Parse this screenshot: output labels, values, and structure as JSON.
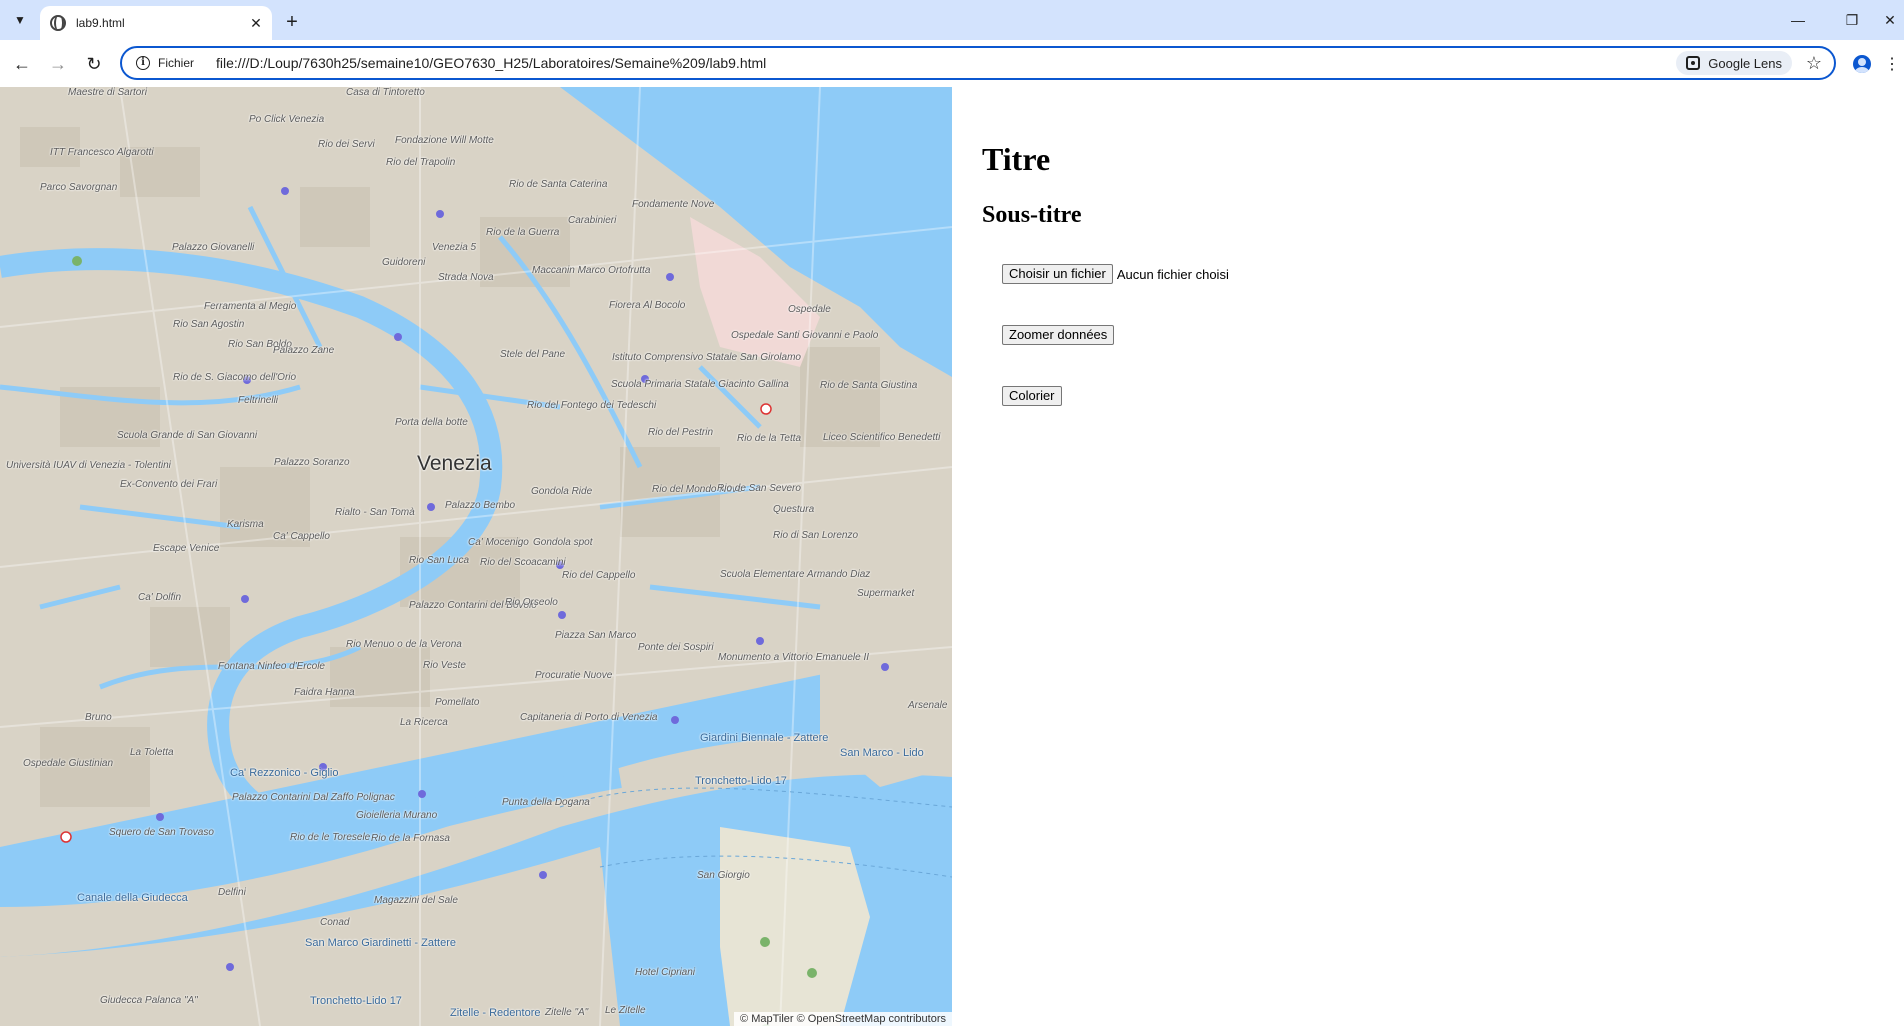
{
  "browser": {
    "tab_title": "lab9.html",
    "site_label": "Fichier",
    "url": "file:///D:/Loup/7630h25/semaine10/GEO7630_H25/Laboratoires/Semaine%209/lab9.html",
    "lens_label": "Google Lens"
  },
  "map": {
    "city_label": "Venezia",
    "labels": [
      {
        "text": "Maestre di Sartori"
      },
      {
        "text": "Casa di Tintoretto"
      },
      {
        "text": "Po Click Venezia"
      },
      {
        "text": "Rio dei Servi"
      },
      {
        "text": "Fondazione Will Motte"
      },
      {
        "text": "Rio del Trapolin"
      },
      {
        "text": "ITT Francesco Algarotti"
      },
      {
        "text": "Parco Savorgnan"
      },
      {
        "text": "Rio de Santa Caterina"
      },
      {
        "text": "Carabinieri"
      },
      {
        "text": "Fondamente Nove"
      },
      {
        "text": "Palazzo Giovanelli"
      },
      {
        "text": "Venezia 5"
      },
      {
        "text": "Rio de la Guerra"
      },
      {
        "text": "Guidoreni"
      },
      {
        "text": "Maccanin Marco Ortofrutta"
      },
      {
        "text": "Ferramenta al Megio"
      },
      {
        "text": "Strada Nova"
      },
      {
        "text": "Fiorera Al Bocolo"
      },
      {
        "text": "Ospedale"
      },
      {
        "text": "Rio San Agostin"
      },
      {
        "text": "Rio San Boldo"
      },
      {
        "text": "Palazzo Zane"
      },
      {
        "text": "Ospedale Santi Giovanni e Paolo"
      },
      {
        "text": "Stele del Pane"
      },
      {
        "text": "Istituto Comprensivo Statale San Girolamo"
      },
      {
        "text": "Rio de S. Giacomo dell'Orio"
      },
      {
        "text": "Feltrinelli"
      },
      {
        "text": "Scuola Primaria Statale Giacinto Gallina"
      },
      {
        "text": "Rio de Santa Giustina"
      },
      {
        "text": "Porta della botte"
      },
      {
        "text": "Rio del Fontego dei Tedeschi"
      },
      {
        "text": "Scuola Grande di San Giovanni"
      },
      {
        "text": "Rio del Pestrin"
      },
      {
        "text": "Rio de la Tetta"
      },
      {
        "text": "Liceo Scientifico Benedetti"
      },
      {
        "text": "Palazzo Soranzo"
      },
      {
        "text": "Università IUAV di Venezia - Tolentini"
      },
      {
        "text": "Ex-Convento dei Frari"
      },
      {
        "text": "Gondola Ride"
      },
      {
        "text": "Rio del Mondo Novo"
      },
      {
        "text": "Rio de San Severo"
      },
      {
        "text": "Questura"
      },
      {
        "text": "Palazzo Bembo"
      },
      {
        "text": "Karisma"
      },
      {
        "text": "Ca' Cappello"
      },
      {
        "text": "Rialto - San Tomà"
      },
      {
        "text": "Ca' Mocenigo"
      },
      {
        "text": "Gondola spot"
      },
      {
        "text": "Rio di San Lorenzo"
      },
      {
        "text": "Escape Venice"
      },
      {
        "text": "Rio San Luca"
      },
      {
        "text": "Rio del Scoacamini"
      },
      {
        "text": "Rio del Cappello"
      },
      {
        "text": "Scuola Elementare Armando Diaz"
      },
      {
        "text": "Supermarket"
      },
      {
        "text": "Ca' Dolfin"
      },
      {
        "text": "Palazzo Contarini del Bovolo"
      },
      {
        "text": "Rio Orseolo"
      },
      {
        "text": "Piazza San Marco"
      },
      {
        "text": "Ponte dei Sospiri"
      },
      {
        "text": "Monumento a Vittorio Emanuele II"
      },
      {
        "text": "Rio Menuo o de la Verona"
      },
      {
        "text": "Rio Veste"
      },
      {
        "text": "Procuratie Nuove"
      },
      {
        "text": "Fontana Ninfeo d'Ercole"
      },
      {
        "text": "Faidra Hanna"
      },
      {
        "text": "Pomellato"
      },
      {
        "text": "La Ricerca"
      },
      {
        "text": "Capitaneria di Porto di Venezia"
      },
      {
        "text": "Giardini Biennale - Zattere"
      },
      {
        "text": "San Marco - Lido"
      },
      {
        "text": "Arsenale"
      },
      {
        "text": "Bruno"
      },
      {
        "text": "La Toletta"
      },
      {
        "text": "Ca' Rezzonico - Giglio"
      },
      {
        "text": "Tronchetto-Lido 17"
      },
      {
        "text": "Ospedale Giustinian"
      },
      {
        "text": "Palazzo Contarini Dal Zaffo Polignac"
      },
      {
        "text": "Gioielleria Murano"
      },
      {
        "text": "Punta della Dogana"
      },
      {
        "text": "Squero de San Trovaso"
      },
      {
        "text": "Rio de le Toresele"
      },
      {
        "text": "Rio de la Fornasa"
      },
      {
        "text": "San Giorgio"
      },
      {
        "text": "Canale della Giudecca"
      },
      {
        "text": "Delfini"
      },
      {
        "text": "Magazzini del Sale"
      },
      {
        "text": "Conad"
      },
      {
        "text": "San Marco Giardinetti - Zattere"
      },
      {
        "text": "Hotel Cipriani"
      },
      {
        "text": "Giudecca Palanca \"A\""
      },
      {
        "text": "Tronchetto-Lido 17"
      },
      {
        "text": "Zitelle \"A\""
      },
      {
        "text": "Le Zitelle"
      },
      {
        "text": "Zitelle - Redentore"
      }
    ],
    "attribution": "© MapTiler © OpenStreetMap contributors"
  },
  "panel": {
    "title": "Titre",
    "subtitle": "Sous-titre",
    "file_button_label": "Choisir un fichier",
    "file_status": "Aucun fichier choisi",
    "zoom_button_label": "Zoomer données",
    "color_button_label": "Colorier"
  }
}
